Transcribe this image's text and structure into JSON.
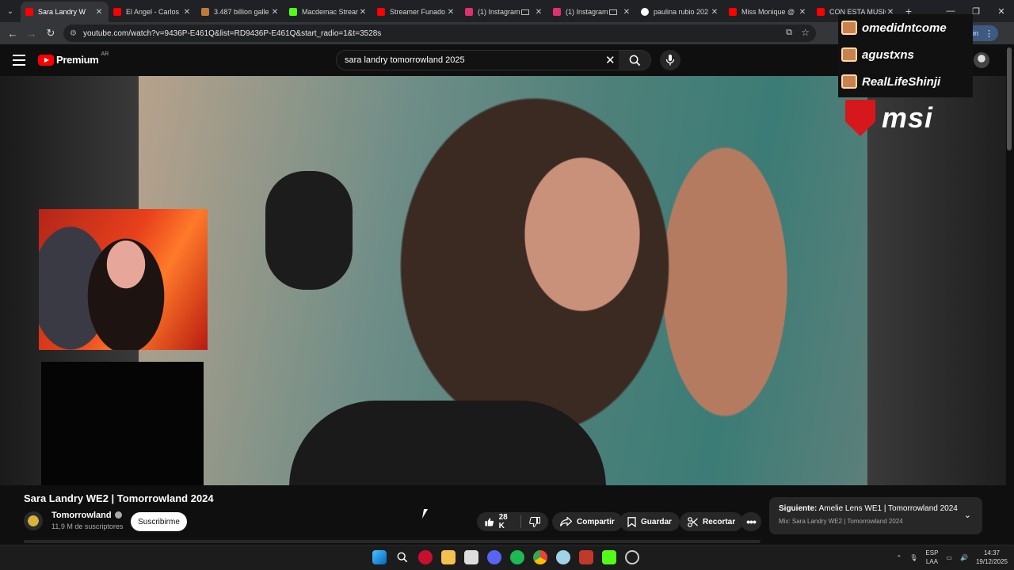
{
  "browser": {
    "tabs": [
      {
        "title": "Sara Landry W",
        "favicon_color": "#ff0000",
        "active": true
      },
      {
        "title": "El Angel - Carlos",
        "favicon_color": "#ff0000",
        "active": false
      },
      {
        "title": "3.487 billion galle",
        "favicon_color": "#c27a3a",
        "active": false
      },
      {
        "title": "Macdemac Strean",
        "favicon_color": "#53fc18",
        "active": false
      },
      {
        "title": "Streamer Funado",
        "favicon_color": "#ff0000",
        "active": false
      },
      {
        "title": "(1) Instagram",
        "favicon_color": "#e1306c",
        "active": false
      },
      {
        "title": "(1) Instagram",
        "favicon_color": "#e1306c",
        "active": false
      },
      {
        "title": "paulina rubio 202",
        "favicon_color": "#ffffff",
        "active": false
      },
      {
        "title": "Miss Monique @",
        "favicon_color": "#ff0000",
        "active": false
      },
      {
        "title": "CON ESTA MUSIC",
        "favicon_color": "#ff0000",
        "active": false
      }
    ],
    "url": "youtube.com/watch?v=9436P-E461Q&list=RD9436P-E461Q&start_radio=1&t=3528s",
    "update_label": "alización"
  },
  "youtube": {
    "logo_text": "Premium",
    "region": "AR",
    "search_query": "sara landry tomorrowland 2025"
  },
  "overlay": {
    "names": [
      "omedidntcome",
      "agustxns",
      "RealLifeShinji"
    ],
    "sponsor": "msi"
  },
  "video": {
    "title": "Sara Landry WE2 | Tomorrowland 2024",
    "channel": "Tomorrowland",
    "subscribers": "11,9 M de suscriptores",
    "subscribe_label": "Suscribirme",
    "likes": "28 K",
    "share_label": "Compartir",
    "save_label": "Guardar",
    "clip_label": "Recortar"
  },
  "next_up": {
    "prefix": "Siguiente:",
    "title": "Amelie Lens WE1 | Tomorrowland 2024",
    "mix": "Mix: Sara Landry WE2 | Tomorrowland 2024"
  },
  "taskbar": {
    "lang_top": "ESP",
    "lang_bottom": "LAA",
    "time": "14:37",
    "date": "19/12/2025"
  }
}
